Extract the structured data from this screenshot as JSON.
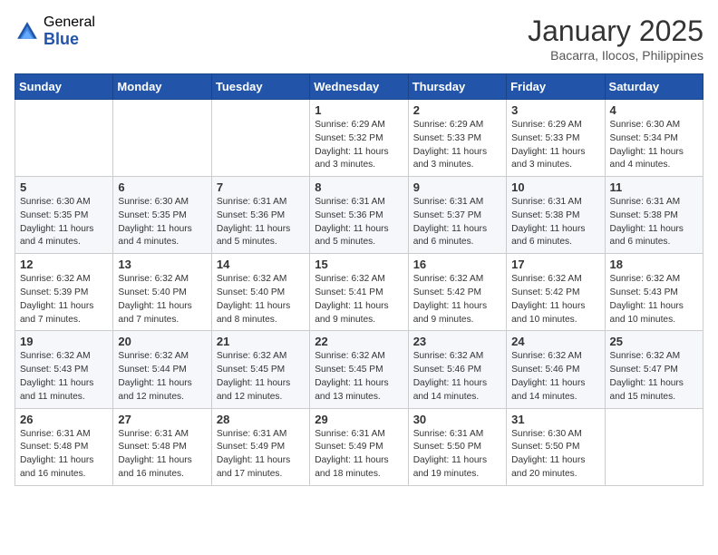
{
  "header": {
    "logo_general": "General",
    "logo_blue": "Blue",
    "month_title": "January 2025",
    "location": "Bacarra, Ilocos, Philippines"
  },
  "weekdays": [
    "Sunday",
    "Monday",
    "Tuesday",
    "Wednesday",
    "Thursday",
    "Friday",
    "Saturday"
  ],
  "weeks": [
    [
      {
        "day": "",
        "info": ""
      },
      {
        "day": "",
        "info": ""
      },
      {
        "day": "",
        "info": ""
      },
      {
        "day": "1",
        "info": "Sunrise: 6:29 AM\nSunset: 5:32 PM\nDaylight: 11 hours\nand 3 minutes."
      },
      {
        "day": "2",
        "info": "Sunrise: 6:29 AM\nSunset: 5:33 PM\nDaylight: 11 hours\nand 3 minutes."
      },
      {
        "day": "3",
        "info": "Sunrise: 6:29 AM\nSunset: 5:33 PM\nDaylight: 11 hours\nand 3 minutes."
      },
      {
        "day": "4",
        "info": "Sunrise: 6:30 AM\nSunset: 5:34 PM\nDaylight: 11 hours\nand 4 minutes."
      }
    ],
    [
      {
        "day": "5",
        "info": "Sunrise: 6:30 AM\nSunset: 5:35 PM\nDaylight: 11 hours\nand 4 minutes."
      },
      {
        "day": "6",
        "info": "Sunrise: 6:30 AM\nSunset: 5:35 PM\nDaylight: 11 hours\nand 4 minutes."
      },
      {
        "day": "7",
        "info": "Sunrise: 6:31 AM\nSunset: 5:36 PM\nDaylight: 11 hours\nand 5 minutes."
      },
      {
        "day": "8",
        "info": "Sunrise: 6:31 AM\nSunset: 5:36 PM\nDaylight: 11 hours\nand 5 minutes."
      },
      {
        "day": "9",
        "info": "Sunrise: 6:31 AM\nSunset: 5:37 PM\nDaylight: 11 hours\nand 6 minutes."
      },
      {
        "day": "10",
        "info": "Sunrise: 6:31 AM\nSunset: 5:38 PM\nDaylight: 11 hours\nand 6 minutes."
      },
      {
        "day": "11",
        "info": "Sunrise: 6:31 AM\nSunset: 5:38 PM\nDaylight: 11 hours\nand 6 minutes."
      }
    ],
    [
      {
        "day": "12",
        "info": "Sunrise: 6:32 AM\nSunset: 5:39 PM\nDaylight: 11 hours\nand 7 minutes."
      },
      {
        "day": "13",
        "info": "Sunrise: 6:32 AM\nSunset: 5:40 PM\nDaylight: 11 hours\nand 7 minutes."
      },
      {
        "day": "14",
        "info": "Sunrise: 6:32 AM\nSunset: 5:40 PM\nDaylight: 11 hours\nand 8 minutes."
      },
      {
        "day": "15",
        "info": "Sunrise: 6:32 AM\nSunset: 5:41 PM\nDaylight: 11 hours\nand 9 minutes."
      },
      {
        "day": "16",
        "info": "Sunrise: 6:32 AM\nSunset: 5:42 PM\nDaylight: 11 hours\nand 9 minutes."
      },
      {
        "day": "17",
        "info": "Sunrise: 6:32 AM\nSunset: 5:42 PM\nDaylight: 11 hours\nand 10 minutes."
      },
      {
        "day": "18",
        "info": "Sunrise: 6:32 AM\nSunset: 5:43 PM\nDaylight: 11 hours\nand 10 minutes."
      }
    ],
    [
      {
        "day": "19",
        "info": "Sunrise: 6:32 AM\nSunset: 5:43 PM\nDaylight: 11 hours\nand 11 minutes."
      },
      {
        "day": "20",
        "info": "Sunrise: 6:32 AM\nSunset: 5:44 PM\nDaylight: 11 hours\nand 12 minutes."
      },
      {
        "day": "21",
        "info": "Sunrise: 6:32 AM\nSunset: 5:45 PM\nDaylight: 11 hours\nand 12 minutes."
      },
      {
        "day": "22",
        "info": "Sunrise: 6:32 AM\nSunset: 5:45 PM\nDaylight: 11 hours\nand 13 minutes."
      },
      {
        "day": "23",
        "info": "Sunrise: 6:32 AM\nSunset: 5:46 PM\nDaylight: 11 hours\nand 14 minutes."
      },
      {
        "day": "24",
        "info": "Sunrise: 6:32 AM\nSunset: 5:46 PM\nDaylight: 11 hours\nand 14 minutes."
      },
      {
        "day": "25",
        "info": "Sunrise: 6:32 AM\nSunset: 5:47 PM\nDaylight: 11 hours\nand 15 minutes."
      }
    ],
    [
      {
        "day": "26",
        "info": "Sunrise: 6:31 AM\nSunset: 5:48 PM\nDaylight: 11 hours\nand 16 minutes."
      },
      {
        "day": "27",
        "info": "Sunrise: 6:31 AM\nSunset: 5:48 PM\nDaylight: 11 hours\nand 16 minutes."
      },
      {
        "day": "28",
        "info": "Sunrise: 6:31 AM\nSunset: 5:49 PM\nDaylight: 11 hours\nand 17 minutes."
      },
      {
        "day": "29",
        "info": "Sunrise: 6:31 AM\nSunset: 5:49 PM\nDaylight: 11 hours\nand 18 minutes."
      },
      {
        "day": "30",
        "info": "Sunrise: 6:31 AM\nSunset: 5:50 PM\nDaylight: 11 hours\nand 19 minutes."
      },
      {
        "day": "31",
        "info": "Sunrise: 6:30 AM\nSunset: 5:50 PM\nDaylight: 11 hours\nand 20 minutes."
      },
      {
        "day": "",
        "info": ""
      }
    ]
  ]
}
